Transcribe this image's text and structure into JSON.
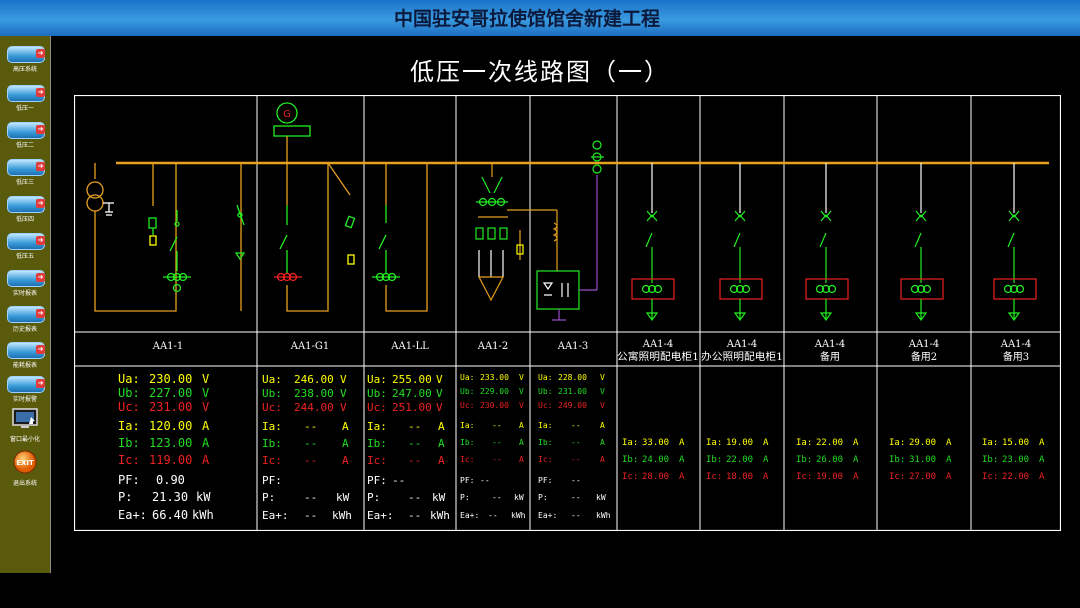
{
  "header": {
    "title": "中国驻安哥拉使馆馆舍新建工程"
  },
  "page_title": "低压一次线路图（一）",
  "sidebar": {
    "items": [
      {
        "label": "高压系统",
        "icon": "nav-button-icon"
      },
      {
        "label": "低压一",
        "icon": "nav-button-icon"
      },
      {
        "label": "低压二",
        "icon": "nav-button-icon"
      },
      {
        "label": "低压三",
        "icon": "nav-button-icon"
      },
      {
        "label": "低压四",
        "icon": "nav-button-icon"
      },
      {
        "label": "低压五",
        "icon": "nav-button-icon"
      },
      {
        "label": "实时报表",
        "icon": "nav-button-icon"
      },
      {
        "label": "历史报表",
        "icon": "nav-button-icon"
      },
      {
        "label": "能耗报表",
        "icon": "nav-button-icon"
      },
      {
        "label": "实时报警",
        "icon": "nav-button-icon"
      },
      {
        "label": "窗口最小化",
        "icon": "monitor-icon"
      },
      {
        "label": "退出系统",
        "icon": "exit-icon",
        "icon_text": "EXIT"
      }
    ]
  },
  "colors": {
    "busbar": "#e8a020",
    "ua": "#ffff00",
    "ub": "#22dd22",
    "uc": "#ee2222",
    "device": "#22ee22",
    "alarm": "#ee2222",
    "purple": "#9b4dca"
  },
  "panels": [
    {
      "name": "AA1-1",
      "ua": {
        "label": "Ua:",
        "value": "230.00",
        "unit": "V"
      },
      "ub": {
        "label": "Ub:",
        "value": "227.00",
        "unit": "V"
      },
      "uc": {
        "label": "Uc:",
        "value": "231.00",
        "unit": "V"
      },
      "ia": {
        "label": "Ia:",
        "value": "120.00",
        "unit": "A"
      },
      "ib": {
        "label": "Ib:",
        "value": "123.00",
        "unit": "A"
      },
      "ic": {
        "label": "Ic:",
        "value": "119.00",
        "unit": "A"
      },
      "pf": {
        "label": "PF:",
        "value": "0.90"
      },
      "p": {
        "label": "P:",
        "value": "21.30",
        "unit": "kW"
      },
      "ea": {
        "label": "Ea+:",
        "value": "66.40",
        "unit": "kWh"
      }
    },
    {
      "name": "AA1-G1",
      "ua": {
        "label": "Ua:",
        "value": "246.00",
        "unit": "V"
      },
      "ub": {
        "label": "Ub:",
        "value": "238.00",
        "unit": "V"
      },
      "uc": {
        "label": "Uc:",
        "value": "244.00",
        "unit": "V"
      },
      "ia": {
        "label": "Ia:",
        "value": "--",
        "unit": "A"
      },
      "ib": {
        "label": "Ib:",
        "value": "--",
        "unit": "A"
      },
      "ic": {
        "label": "Ic:",
        "value": "--",
        "unit": "A"
      },
      "pf": {
        "label": "PF:",
        "value": ""
      },
      "p": {
        "label": "P:",
        "value": "--",
        "unit": "kW"
      },
      "ea": {
        "label": "Ea+:",
        "value": "--",
        "unit": "kWh"
      }
    },
    {
      "name": "AA1-LL",
      "ua": {
        "label": "Ua:",
        "value": "255.00",
        "unit": "V"
      },
      "ub": {
        "label": "Ub:",
        "value": "247.00",
        "unit": "V"
      },
      "uc": {
        "label": "Uc:",
        "value": "251.00",
        "unit": "V"
      },
      "ia": {
        "label": "Ia:",
        "value": "--",
        "unit": "A"
      },
      "ib": {
        "label": "Ib:",
        "value": "--",
        "unit": "A"
      },
      "ic": {
        "label": "Ic:",
        "value": "--",
        "unit": "A"
      },
      "pf": {
        "label": "PF:",
        "value": "--"
      },
      "p": {
        "label": "P:",
        "value": "--",
        "unit": "kW"
      },
      "ea": {
        "label": "Ea+:",
        "value": "--",
        "unit": "kWh"
      }
    },
    {
      "name": "AA1-2",
      "ua": {
        "label": "Ua:",
        "value": "233.00",
        "unit": "V"
      },
      "ub": {
        "label": "Ub:",
        "value": "229.00",
        "unit": "V"
      },
      "uc": {
        "label": "Uc:",
        "value": "230.00",
        "unit": "V"
      },
      "ia": {
        "label": "Ia:",
        "value": "--",
        "unit": "A"
      },
      "ib": {
        "label": "Ib:",
        "value": "--",
        "unit": "A"
      },
      "ic": {
        "label": "Ic:",
        "value": "--",
        "unit": "A"
      },
      "pf": {
        "label": "PF:",
        "value": "--"
      },
      "p": {
        "label": "P:",
        "value": "--",
        "unit": "kW"
      },
      "ea": {
        "label": "Ea+:",
        "value": "--",
        "unit": "kWh"
      }
    },
    {
      "name": "AA1-3",
      "ua": {
        "label": "Ua:",
        "value": "228.00",
        "unit": "V"
      },
      "ub": {
        "label": "Ub:",
        "value": "231.00",
        "unit": "V"
      },
      "uc": {
        "label": "Uc:",
        "value": "249.00",
        "unit": "V"
      },
      "ia": {
        "label": "Ia:",
        "value": "--",
        "unit": "A"
      },
      "ib": {
        "label": "Ib:",
        "value": "--",
        "unit": "A"
      },
      "ic": {
        "label": "Ic:",
        "value": "--",
        "unit": "A"
      },
      "pf": {
        "label": "PF:",
        "value": "--"
      },
      "p": {
        "label": "P:",
        "value": "--",
        "unit": "kW"
      },
      "ea": {
        "label": "Ea+:",
        "value": "--",
        "unit": "kWh"
      }
    }
  ],
  "feeders": [
    {
      "name": "AA1-4",
      "sub": "公寓照明配电柜1",
      "ia": {
        "label": "Ia:",
        "value": "33.00",
        "unit": "A"
      },
      "ib": {
        "label": "Ib:",
        "value": "24.00",
        "unit": "A"
      },
      "ic": {
        "label": "Ic:",
        "value": "28.00",
        "unit": "A"
      }
    },
    {
      "name": "AA1-4",
      "sub": "办公照明配电柜1",
      "ia": {
        "label": "Ia:",
        "value": "19.00",
        "unit": "A"
      },
      "ib": {
        "label": "Ib:",
        "value": "22.00",
        "unit": "A"
      },
      "ic": {
        "label": "Ic:",
        "value": "18.00",
        "unit": "A"
      }
    },
    {
      "name": "AA1-4",
      "sub": "备用",
      "ia": {
        "label": "Ia:",
        "value": "22.00",
        "unit": "A"
      },
      "ib": {
        "label": "Ib:",
        "value": "26.00",
        "unit": "A"
      },
      "ic": {
        "label": "Ic:",
        "value": "19.00",
        "unit": "A"
      }
    },
    {
      "name": "AA1-4",
      "sub": "备用2",
      "ia": {
        "label": "Ia:",
        "value": "29.00",
        "unit": "A"
      },
      "ib": {
        "label": "Ib:",
        "value": "31.00",
        "unit": "A"
      },
      "ic": {
        "label": "Ic:",
        "value": "27.00",
        "unit": "A"
      }
    },
    {
      "name": "AA1-4",
      "sub": "备用3",
      "ia": {
        "label": "Ia:",
        "value": "15.00",
        "unit": "A"
      },
      "ib": {
        "label": "Ib:",
        "value": "23.00",
        "unit": "A"
      },
      "ic": {
        "label": "Ic:",
        "value": "22.00",
        "unit": "A"
      }
    }
  ]
}
